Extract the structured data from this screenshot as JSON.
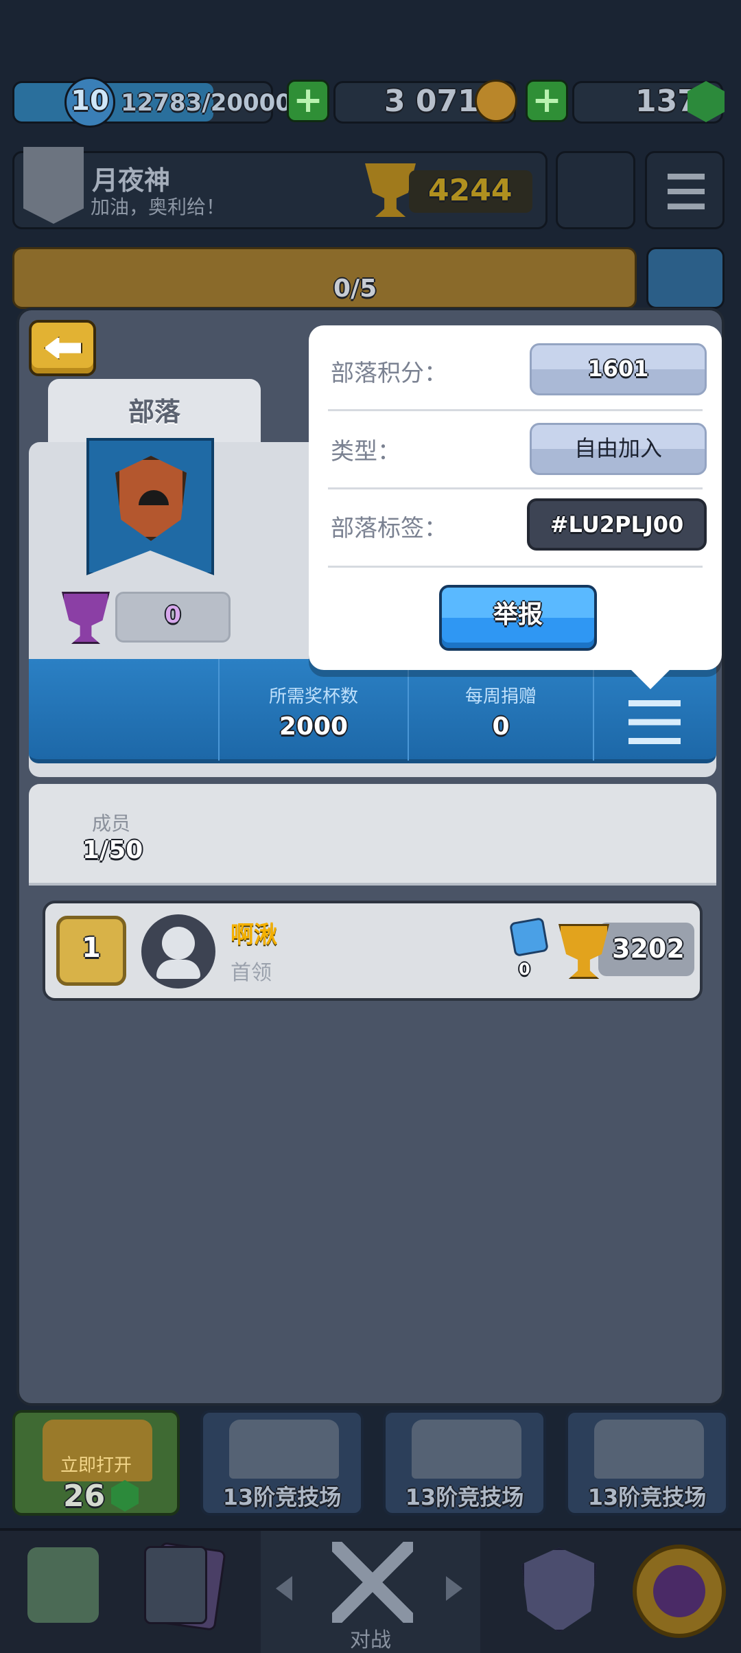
{
  "top_bar": {
    "level": "10",
    "xp": "12783/20000",
    "gold": "3 071",
    "gems": "137"
  },
  "profile": {
    "player_name": "月夜神",
    "motto": "加油，奥利给！",
    "trophies": "4244"
  },
  "pass_progress": "0/5",
  "clan_panel": {
    "tab_label": "部落",
    "clan_trophies": "0",
    "stats": {
      "required_trophies_label": "所需奖杯数",
      "required_trophies_value": "2000",
      "weekly_donations_label": "每周捐赠",
      "weekly_donations_value": "0"
    },
    "members_label": "成员",
    "members_count": "1/50",
    "members": [
      {
        "rank": "1",
        "name": "啊湫",
        "role": "首领",
        "donations": "0",
        "trophies": "3202"
      }
    ]
  },
  "popup": {
    "clan_score_label": "部落积分：",
    "clan_score_value": "1601",
    "type_label": "类型：",
    "type_value": "自由加入",
    "clan_tag_label": "部落标签：",
    "clan_tag_value": "#LU2PLJ00",
    "report_button": "举报"
  },
  "chests": {
    "unlock_label": "立即打开",
    "unlock_cost": "26",
    "slots": [
      "13阶竞技场",
      "13阶竞技场",
      "13阶竞技场"
    ]
  },
  "bottom_nav": {
    "battle_label": "对战"
  },
  "colors": {
    "popup_bg": "#ffffff",
    "report_button": "#2f97f3",
    "stats_bar": "#2279bb",
    "panel_bg": "#4a5466",
    "gold_text": "#f4b000"
  }
}
